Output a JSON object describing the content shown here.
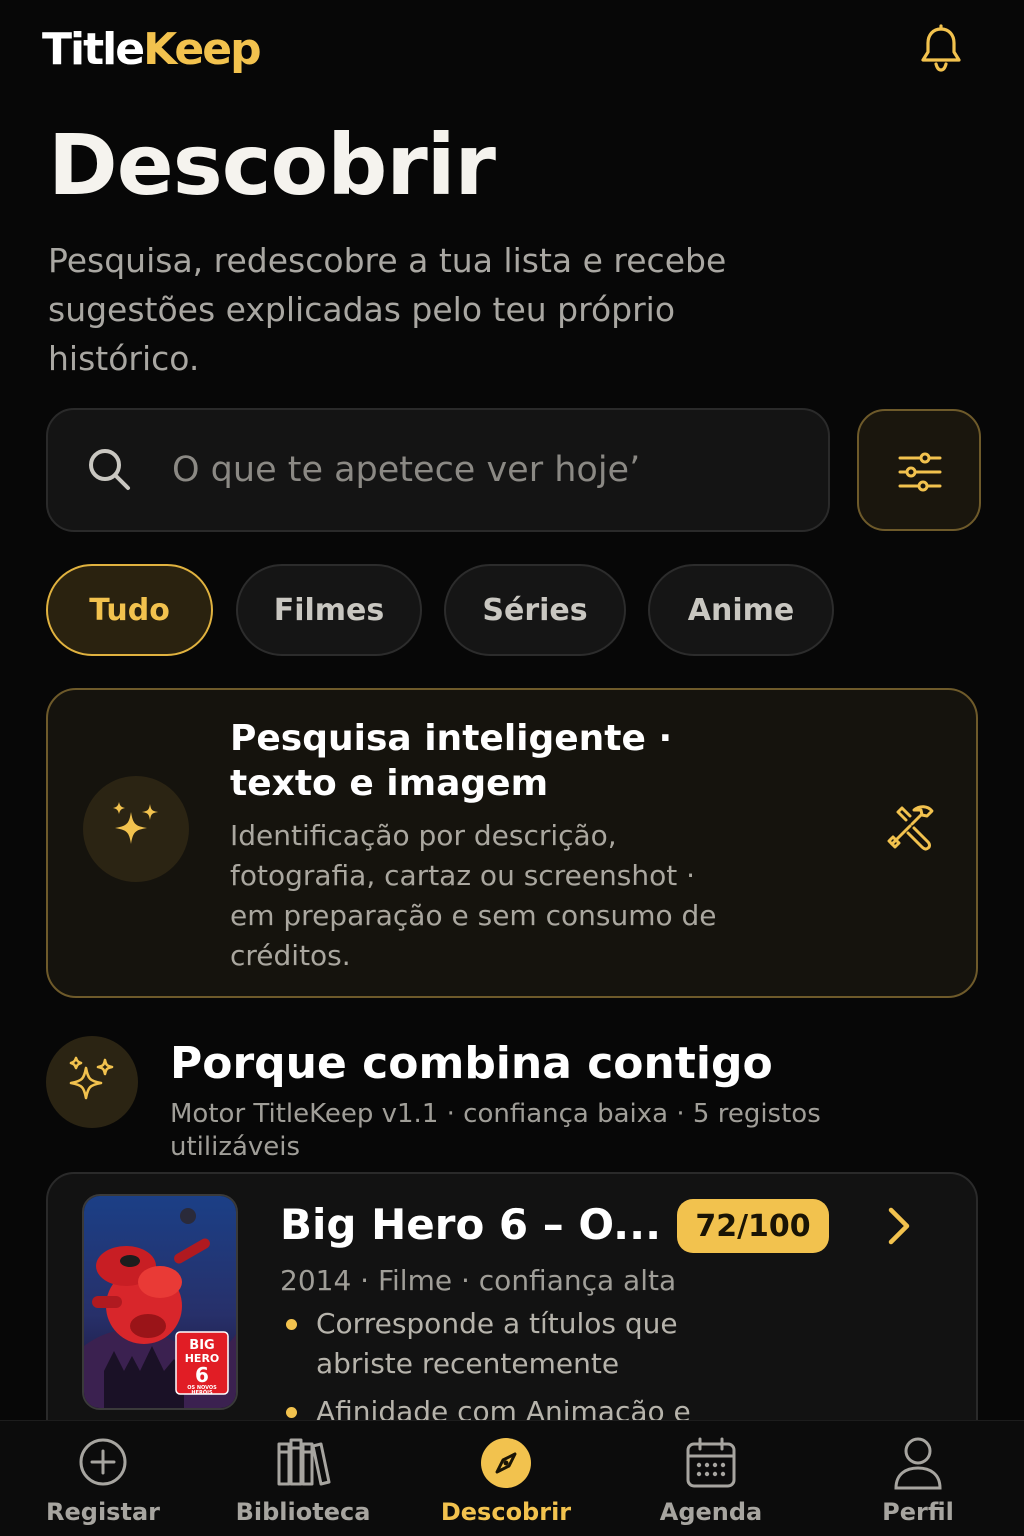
{
  "app": {
    "logo_part1": "Title",
    "logo_part2": "Keep",
    "accent_color": "#f2c24e"
  },
  "header": {
    "notifications_icon": "bell-icon"
  },
  "page": {
    "title": "Descobrir",
    "subtitle": "Pesquisa, redescobre a tua lista e recebe sugestões explicadas pelo teu próprio histórico."
  },
  "search": {
    "placeholder": "O que te apetece ver hoje’",
    "value": "",
    "icon": "search-icon",
    "filter_icon": "sliders-icon"
  },
  "filters": {
    "tabs": [
      {
        "label": "Tudo",
        "active": true
      },
      {
        "label": "Filmes",
        "active": false
      },
      {
        "label": "Séries",
        "active": false
      },
      {
        "label": "Anime",
        "active": false
      }
    ]
  },
  "smart_search": {
    "title": "Pesquisa inteligente · texto e imagem",
    "description": "Identificação por descrição, fotografia, cartaz ou screenshot · em preparação e sem consumo de créditos.",
    "icon": "sparkles-icon",
    "status_icon": "tools-icon"
  },
  "recommendations": {
    "title": "Porque combina contigo",
    "meta": "Motor TitleKeep v1.1 · confiança baixa · 5 registos utilizáveis",
    "icon": "sparkles-icon",
    "items": [
      {
        "title": "Big Hero 6 – O...",
        "score": "72/100",
        "meta": "2014 · Filme · confiança alta",
        "reasons": [
          "Corresponde a títulos que abriste recentemente",
          "Afinidade com Animação e"
        ],
        "poster_text": [
          "BIG",
          "HERO",
          "6",
          "OS NOVOS",
          "HERÓIS"
        ]
      }
    ]
  },
  "nav": {
    "items": [
      {
        "label": "Registar",
        "icon": "plus-circle-icon",
        "active": false
      },
      {
        "label": "Biblioteca",
        "icon": "library-icon",
        "active": false
      },
      {
        "label": "Descobrir",
        "icon": "compass-icon",
        "active": true
      },
      {
        "label": "Agenda",
        "icon": "calendar-icon",
        "active": false
      },
      {
        "label": "Perfil",
        "icon": "user-icon",
        "active": false
      }
    ]
  }
}
